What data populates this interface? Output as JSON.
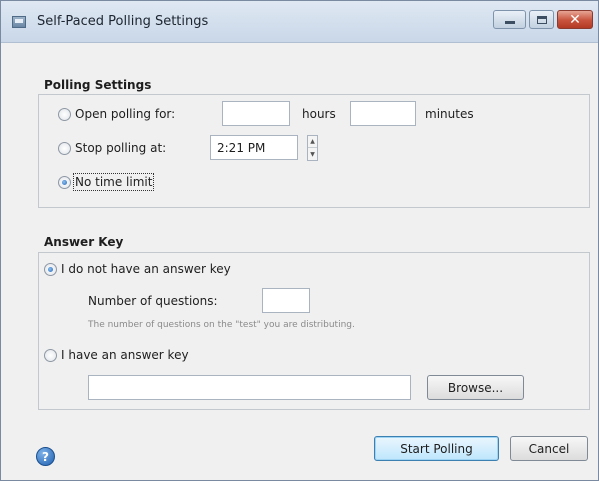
{
  "window": {
    "title": "Self-Paced Polling Settings",
    "icons": {
      "app": "dialog-app-icon",
      "minimize": "minimize-icon",
      "maximize": "maximize-icon",
      "close": "close-icon",
      "help": "help-icon"
    },
    "close_glyph": "✕"
  },
  "polling": {
    "section_title": "Polling Settings",
    "option_open_label": "Open polling for:",
    "hours_value": "",
    "hours_label": "hours",
    "minutes_value": "",
    "minutes_label": "minutes",
    "option_stop_label": "Stop polling at:",
    "stop_time_value": "2:21 PM",
    "option_no_limit_label": "No time limit",
    "selected_option": "No time limit"
  },
  "answer_key": {
    "section_title": "Answer Key",
    "option_no_key_label": "I do not have an answer key",
    "num_questions_label": "Number of questions:",
    "num_questions_value": "",
    "hint": "The number of questions on the \"test\" you are distributing.",
    "option_have_key_label": "I have an answer key",
    "file_path_value": "",
    "browse_label": "Browse...",
    "selected_option": "I do not have an answer key"
  },
  "footer": {
    "help_glyph": "?",
    "start_label": "Start Polling",
    "cancel_label": "Cancel"
  },
  "colors": {
    "accent": "#1f65b8",
    "close_button": "#c8533d",
    "primary_button": "#bee6fd"
  }
}
